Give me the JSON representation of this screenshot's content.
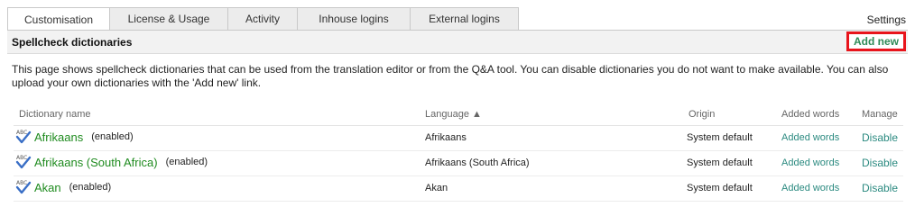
{
  "tabs": [
    {
      "label": "Customisation",
      "active": true
    },
    {
      "label": "License & Usage",
      "active": false
    },
    {
      "label": "Activity",
      "active": false
    },
    {
      "label": "Inhouse logins",
      "active": false
    },
    {
      "label": "External logins",
      "active": false
    }
  ],
  "settings_label": "Settings",
  "panel": {
    "title": "Spellcheck dictionaries",
    "add_new_label": "Add new",
    "description": "This page shows spellcheck dictionaries that can be used from the translation editor or from the Q&A tool. You can disable dictionaries you do not want to make available. You can also upload your own dictionaries with the 'Add new' link."
  },
  "table": {
    "headers": {
      "name": "Dictionary name",
      "language": "Language ▲",
      "origin": "Origin",
      "added_words": "Added words",
      "manage": "Manage"
    },
    "rows": [
      {
        "name": "Afrikaans",
        "status": "(enabled)",
        "language": "Afrikaans",
        "origin": "System default",
        "added_words": "Added words",
        "action": "Disable"
      },
      {
        "name": "Afrikaans (South Africa)",
        "status": "(enabled)",
        "language": "Afrikaans (South Africa)",
        "origin": "System default",
        "added_words": "Added words",
        "action": "Disable"
      },
      {
        "name": "Akan",
        "status": "(enabled)",
        "language": "Akan",
        "origin": "System default",
        "added_words": "Added words",
        "action": "Disable"
      }
    ]
  },
  "colors": {
    "accent_green": "#1f8b1f",
    "link_teal": "#2b8a80",
    "highlight_red": "#e8141b"
  },
  "icons": {
    "dictionary": "abc-spellcheck-icon"
  }
}
